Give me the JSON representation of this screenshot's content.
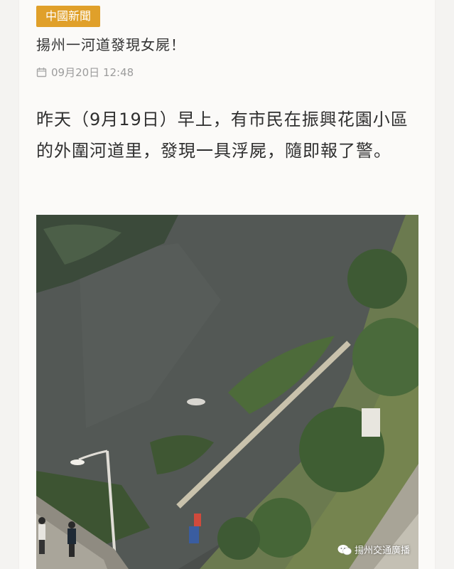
{
  "article": {
    "category_badge": "中國新聞",
    "title": "揚州一河道發現女屍！",
    "date": "09月20日 12:48",
    "body": "昨天（9月19日）早上，有市民在振興花園小區的外圍河道里，發現一具浮屍，隨即報了警。"
  },
  "photo": {
    "watermark": "揚州交通廣播"
  },
  "icons": {
    "date": "calendar-icon",
    "watermark": "wechat-icon"
  },
  "colors": {
    "badge": "#e0a02a",
    "page_bg": "#f4f3f1",
    "card_bg": "#fbfaf8"
  }
}
